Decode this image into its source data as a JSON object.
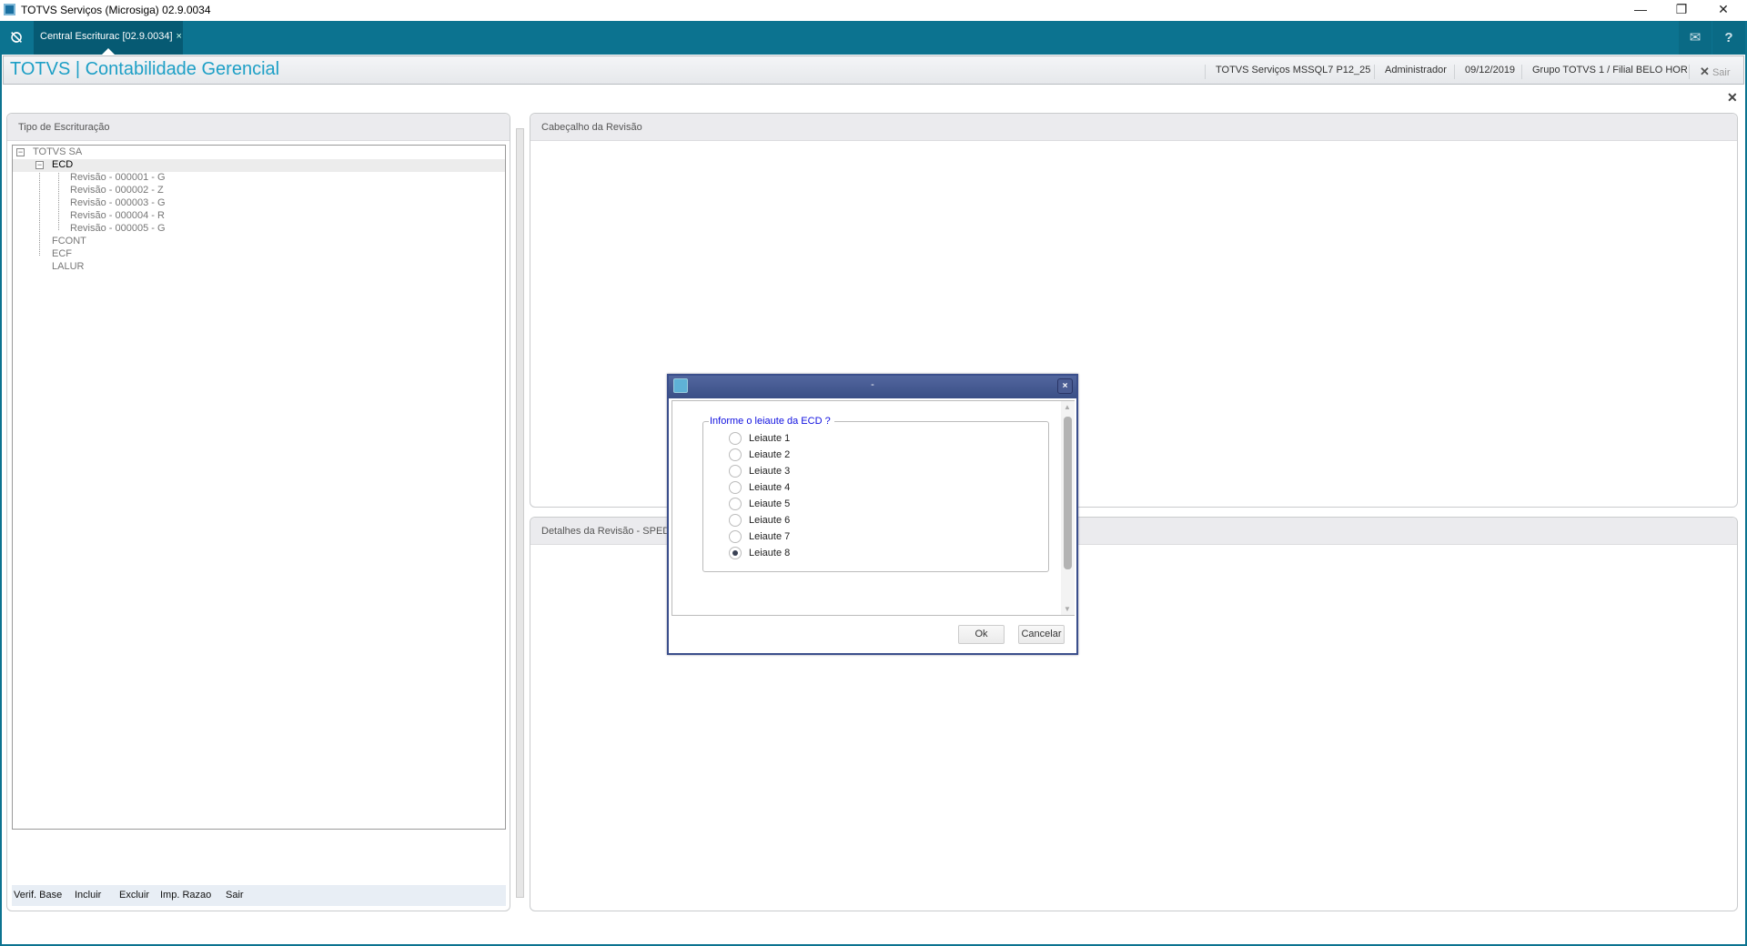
{
  "window": {
    "title": "TOTVS Serviços (Microsiga) 02.9.0034",
    "minimize": "—",
    "restore": "❐",
    "close": "✕"
  },
  "topbar": {
    "home_icon": "⍉",
    "tab_label": "Central Escriturac [02.9.0034]",
    "tab_close": "×",
    "mail_icon": "✉",
    "help_icon": "?"
  },
  "header": {
    "title": "TOTVS | Contabilidade Gerencial",
    "server": "TOTVS Serviços MSSQL7 P12_25",
    "user": "Administrador",
    "date": "09/12/2019",
    "company": "Grupo TOTVS 1 / Filial BELO HOR",
    "exit_icon": "✕",
    "exit_label": "Sair",
    "close": "✕"
  },
  "left_panel": {
    "title": "Tipo de Escrituração",
    "tree": {
      "root": "TOTVS SA",
      "ecd": "ECD",
      "revisions": [
        "Revisão - 000001 - G",
        "Revisão - 000002 - Z",
        "Revisão - 000003 - G",
        "Revisão - 000004 - R",
        "Revisão - 000005 - G"
      ],
      "others": [
        "FCONT",
        "ECF",
        "LALUR"
      ]
    },
    "toolbar": [
      "Verif. Base",
      "Incluir",
      "Excluir",
      "Imp. Razao",
      "Sair"
    ]
  },
  "right_top": {
    "title": "Cabeçalho da Revisão"
  },
  "right_bottom": {
    "title": "Detalhes da Revisão - SPED"
  },
  "dialog": {
    "title": "-",
    "close": "×",
    "question": "Informe o leiaute da ECD  ?",
    "options": [
      "Leiaute 1",
      "Leiaute 2",
      "Leiaute 3",
      "Leiaute 4",
      "Leiaute 5",
      "Leiaute 6",
      "Leiaute 7",
      "Leiaute 8"
    ],
    "selected_index": 7,
    "ok": "Ok",
    "cancel": "Cancelar"
  },
  "colors": {
    "brand": "#0c7390",
    "title_accent": "#1d9fc6",
    "dialog_title": "#3a4f86"
  }
}
